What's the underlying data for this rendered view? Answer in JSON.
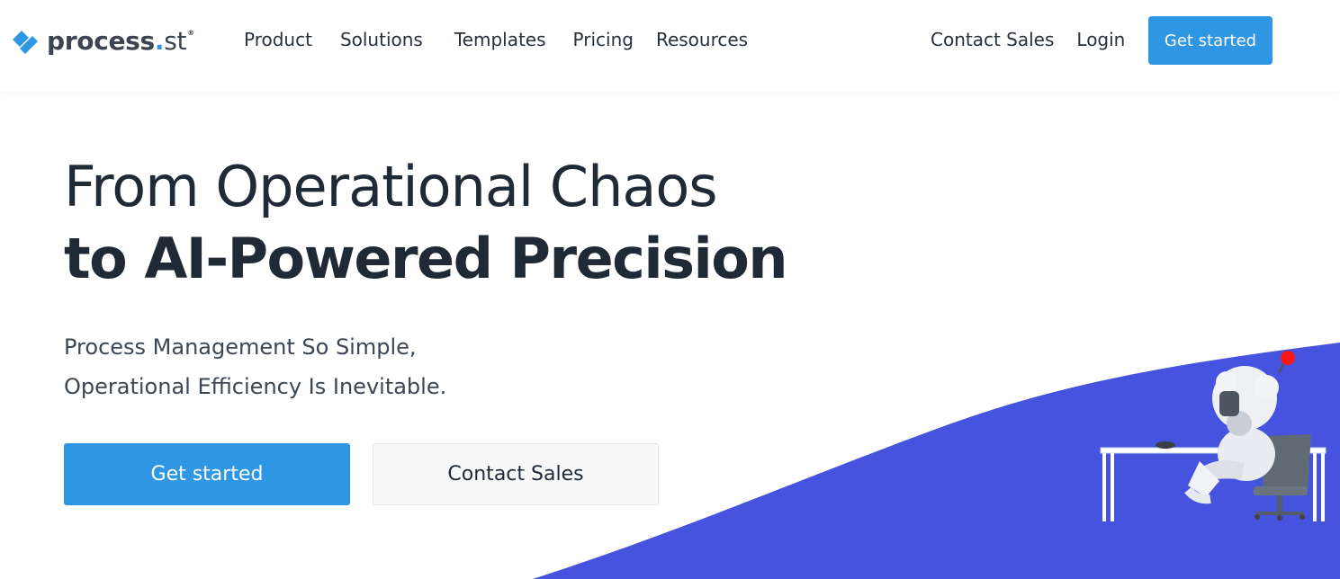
{
  "header": {
    "logo": {
      "name_main": "process",
      "name_dot": ".",
      "name_suffix": "st",
      "registered_mark": "®"
    },
    "nav": [
      {
        "label": "Product"
      },
      {
        "label": "Solutions"
      },
      {
        "label": "Templates"
      },
      {
        "label": "Pricing"
      },
      {
        "label": "Resources"
      }
    ],
    "contact_sales": "Contact Sales",
    "login": "Login",
    "get_started": "Get started"
  },
  "hero": {
    "title_line1": "From Operational Chaos",
    "title_line2": "to AI-Powered Precision",
    "subtitle_line1": "Process Management So Simple,",
    "subtitle_line2": "Operational Efficiency Is Inevitable.",
    "primary_cta": "Get started",
    "secondary_cta": "Contact Sales"
  },
  "colors": {
    "brand_blue": "#2f96e3",
    "wave_purple": "#4653df",
    "text_dark": "#1f2a36"
  },
  "illustration": {
    "icon": "robot-at-desk-illustration"
  }
}
